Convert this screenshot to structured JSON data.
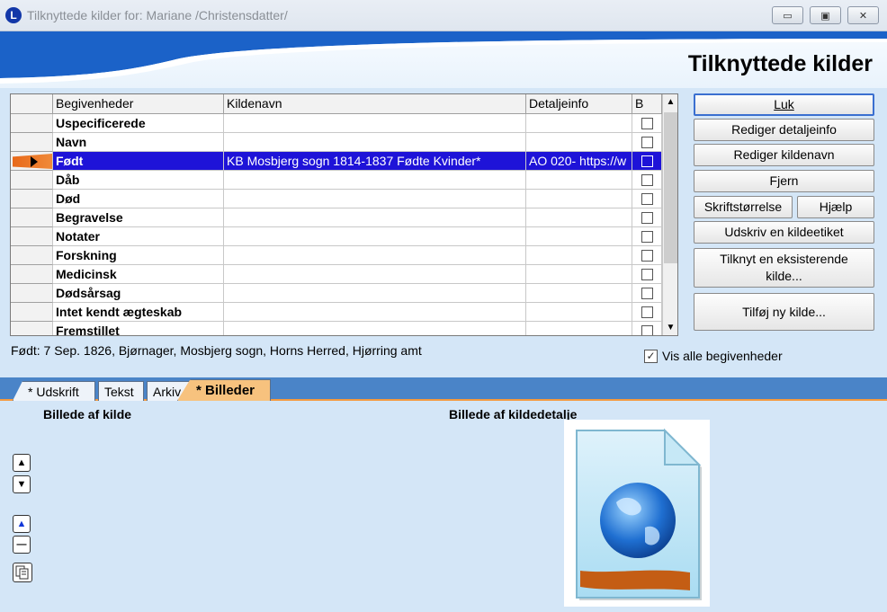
{
  "window": {
    "title": "Tilknyttede kilder for: Mariane /Christensdatter/",
    "app_icon_letter": "L",
    "minimize_glyph": "▭",
    "maximize_glyph": "▣",
    "close_glyph": "✕"
  },
  "header": {
    "title": "Tilknyttede kilder"
  },
  "grid": {
    "columns": [
      "Begivenheder",
      "Kildenavn",
      "Detaljeinfo",
      "B"
    ],
    "rows": [
      {
        "event": "Uspecificerede",
        "source": "",
        "detail": "",
        "selected": false
      },
      {
        "event": "Navn",
        "source": "",
        "detail": "",
        "selected": false
      },
      {
        "event": "Født",
        "source": "KB Mosbjerg sogn 1814-1837 Fødte Kvinder*",
        "detail": "AO 020- https://w",
        "selected": true
      },
      {
        "event": "Dåb",
        "source": "",
        "detail": "",
        "selected": false
      },
      {
        "event": "Død",
        "source": "",
        "detail": "",
        "selected": false
      },
      {
        "event": "Begravelse",
        "source": "",
        "detail": "",
        "selected": false
      },
      {
        "event": "Notater",
        "source": "",
        "detail": "",
        "selected": false
      },
      {
        "event": "Forskning",
        "source": "",
        "detail": "",
        "selected": false
      },
      {
        "event": "Medicinsk",
        "source": "",
        "detail": "",
        "selected": false
      },
      {
        "event": "Dødsårsag",
        "source": "",
        "detail": "",
        "selected": false
      },
      {
        "event": "Intet kendt ægteskab",
        "source": "",
        "detail": "",
        "selected": false
      },
      {
        "event": "Fremstillet",
        "source": "",
        "detail": "",
        "selected": false
      }
    ],
    "scroll_up": "▲",
    "scroll_down": "▼"
  },
  "buttons": {
    "luk": "Luk",
    "rediger_detaljeinfo": "Rediger detaljeinfo",
    "rediger_kildenavn": "Rediger kildenavn",
    "fjern": "Fjern",
    "skriftstorrelse": "Skriftstørrelse",
    "hjaelp": "Hjælp",
    "udskriv": "Udskriv en kildeetiket",
    "tilknyt_line1": "Tilknyt en eksisterende",
    "tilknyt_line2": "kilde...",
    "tilfoej": "Tilføj ny kilde..."
  },
  "status_line": "Født: 7 Sep. 1826, Bjørnager, Mosbjerg sogn, Horns Herred, Hjørring amt",
  "vis_alle": {
    "label": "Vis alle begivenheder",
    "checked": true,
    "check_glyph": "✓"
  },
  "tabs": [
    "* Udskrift",
    "Tekst",
    "Arkiv",
    "* Billeder"
  ],
  "lower": {
    "left_label": "Billede af kilde",
    "right_label": "Billede af kildedetalje",
    "ctrl_up": "▲",
    "ctrl_down": "▼",
    "ctrl_zoom_in": "▲",
    "ctrl_zoom_out": "—"
  },
  "colors": {
    "selection": "#1e13d8",
    "title_text": "#8a8f96",
    "tab_bar": "#4a84c8",
    "active_tab": "#f7c27e",
    "banner_blue": "#1b62c8",
    "pane_bg": "#d4e6f7"
  }
}
